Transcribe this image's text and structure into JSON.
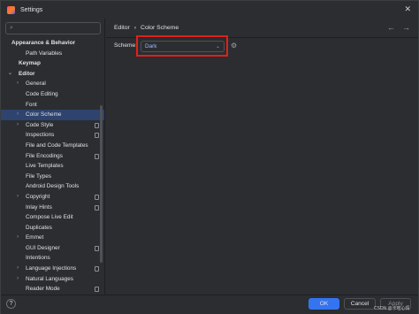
{
  "window": {
    "title": "Settings"
  },
  "search": {
    "placeholder": ""
  },
  "tree": [
    {
      "label": "Appearance & Behavior",
      "bold": true,
      "indent": 12,
      "chevron": ""
    },
    {
      "label": "Path Variables",
      "bold": false,
      "indent": 28,
      "chevron": ""
    },
    {
      "label": "Keymap",
      "bold": true,
      "indent": 20,
      "chevron": ""
    },
    {
      "label": "Editor",
      "bold": true,
      "indent": 20,
      "chevron": "down"
    },
    {
      "label": "General",
      "bold": false,
      "indent": 28,
      "chevron": "right"
    },
    {
      "label": "Code Editing",
      "bold": false,
      "indent": 28,
      "chevron": ""
    },
    {
      "label": "Font",
      "bold": false,
      "indent": 28,
      "chevron": ""
    },
    {
      "label": "Color Scheme",
      "bold": false,
      "indent": 28,
      "chevron": "right",
      "selected": true
    },
    {
      "label": "Code Style",
      "bold": false,
      "indent": 28,
      "chevron": "right",
      "mark": true
    },
    {
      "label": "Inspections",
      "bold": false,
      "indent": 28,
      "chevron": "",
      "mark": true
    },
    {
      "label": "File and Code Templates",
      "bold": false,
      "indent": 28,
      "chevron": ""
    },
    {
      "label": "File Encodings",
      "bold": false,
      "indent": 28,
      "chevron": "",
      "mark": true
    },
    {
      "label": "Live Templates",
      "bold": false,
      "indent": 28,
      "chevron": ""
    },
    {
      "label": "File Types",
      "bold": false,
      "indent": 28,
      "chevron": ""
    },
    {
      "label": "Android Design Tools",
      "bold": false,
      "indent": 28,
      "chevron": ""
    },
    {
      "label": "Copyright",
      "bold": false,
      "indent": 28,
      "chevron": "right",
      "mark": true
    },
    {
      "label": "Inlay Hints",
      "bold": false,
      "indent": 28,
      "chevron": "",
      "mark": true
    },
    {
      "label": "Compose Live Edit",
      "bold": false,
      "indent": 28,
      "chevron": ""
    },
    {
      "label": "Duplicates",
      "bold": false,
      "indent": 28,
      "chevron": ""
    },
    {
      "label": "Emmet",
      "bold": false,
      "indent": 28,
      "chevron": "right"
    },
    {
      "label": "GUI Designer",
      "bold": false,
      "indent": 28,
      "chevron": "",
      "mark": true
    },
    {
      "label": "Intentions",
      "bold": false,
      "indent": 28,
      "chevron": ""
    },
    {
      "label": "Language Injections",
      "bold": false,
      "indent": 28,
      "chevron": "right",
      "mark": true
    },
    {
      "label": "Natural Languages",
      "bold": false,
      "indent": 28,
      "chevron": "right"
    },
    {
      "label": "Reader Mode",
      "bold": false,
      "indent": 28,
      "chevron": "",
      "mark": true
    }
  ],
  "breadcrumb": {
    "parent": "Editor",
    "separator": "›",
    "current": "Color Scheme"
  },
  "nav": {
    "back": "←",
    "forward": "→"
  },
  "scheme": {
    "label": "Scheme:",
    "value": "Dark"
  },
  "buttons": {
    "help": "?",
    "ok": "OK",
    "cancel": "Cancel",
    "apply": "Apply"
  },
  "watermark": "CSDN @卡哇心情",
  "colors": {
    "accent": "#3574f0",
    "selection": "#2e436e",
    "highlight_border": "#e0211a",
    "background": "#2b2d30"
  },
  "icons": {
    "search": "search-icon",
    "settings": "gear-icon",
    "close": "close-icon"
  }
}
